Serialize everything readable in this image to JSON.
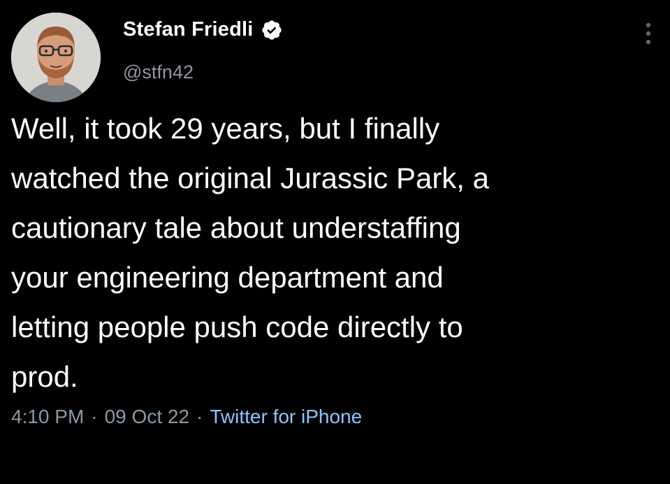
{
  "tweet": {
    "author": {
      "display_name": "Stefan Friedli",
      "handle": "@stfn42",
      "verified": true
    },
    "text": "Well, it took 29 years, but I finally\nwatched the original Jurassic Park, a\ncautionary tale about understaffing\nyour engineering department and\nletting people push code directly to\nprod.",
    "meta": {
      "time": "4:10 PM",
      "separator": "·",
      "date": "09 Oct 22",
      "source": "Twitter for iPhone"
    }
  },
  "colors": {
    "background": "#000000",
    "text_primary": "#ffffff",
    "text_secondary": "#8b98a5",
    "source_link": "#8ec5ff"
  },
  "icons": {
    "verified": "verified-badge-icon",
    "more": "more-options-icon"
  }
}
